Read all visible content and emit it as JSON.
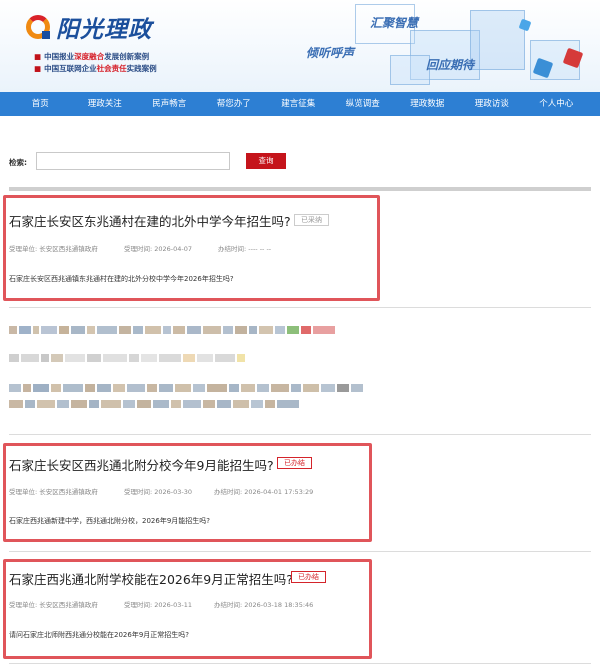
{
  "header": {
    "logo_text": "阳光理政",
    "tagline1_pre": "中国报业",
    "tagline1_hl": "深度融合",
    "tagline1_post": "发展创新案例",
    "tagline2_pre": "中国互联网企业",
    "tagline2_hl": "社会责任",
    "tagline2_post": "实践案例",
    "slogan1": "汇聚智慧",
    "slogan2": "倾听呼声",
    "slogan3": "回应期待"
  },
  "nav": [
    "首页",
    "理政关注",
    "民声畅言",
    "帮您办了",
    "建言征集",
    "纵览调查",
    "理政数据",
    "理政访谈",
    "个人中心"
  ],
  "search": {
    "label": "检索:",
    "value": "",
    "button": "查询"
  },
  "items": [
    {
      "title": "石家庄长安区东兆通村在建的北外中学今年招生吗?",
      "status": "已采纳",
      "status_type": "grey",
      "unit": "受理单位:  长安区西兆通镇政府",
      "accepted": "受理时间:  2026-04-07",
      "handled": "办结时间:  ---- -- --",
      "desc": "石家庄长安区西兆通镇东兆通村在建的北外分校中学今年2026年招生吗?"
    },
    {
      "title": "石家庄长安区西兆通北附分校今年9月能招生吗?",
      "status": "已办结",
      "status_type": "red",
      "unit": "受理单位:  长安区西兆通镇政府",
      "accepted": "受理时间:  2026-03-30",
      "handled": "办结时间:  2026-04-01 17:53:29",
      "desc": "石家庄西兆通新建中学，西兆通北附分校，2026年9月能招生吗?"
    },
    {
      "title": "石家庄西兆通北附学校能在2026年9月正常招生吗?",
      "status": "已办结",
      "status_type": "red",
      "unit": "受理单位:  长安区西兆通镇政府",
      "accepted": "受理时间:  2026-03-11",
      "handled": "办结时间:  2026-03-18 18:35:46",
      "desc": "请问石家庄北师附西兆通分校能在2026年9月正常招生吗?"
    }
  ],
  "colors": {
    "nav_bg": "#2d7fd3",
    "accent_red": "#c5141b",
    "highlight_border": "#e0555a"
  }
}
